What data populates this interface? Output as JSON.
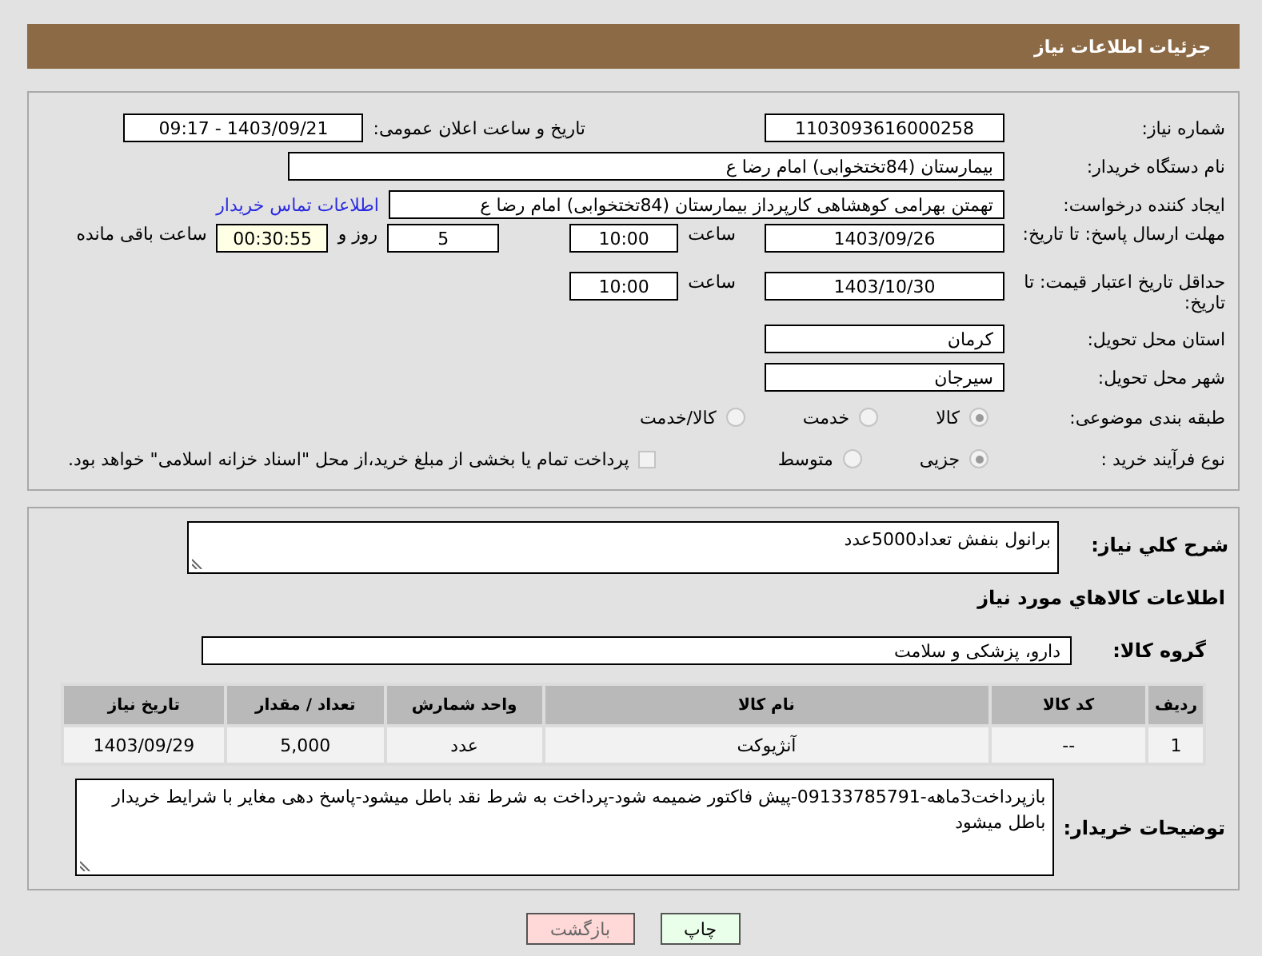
{
  "header": {
    "title": "جزئیات اطلاعات نیاز"
  },
  "need_number": {
    "label": "شماره نیاز:",
    "value": "1103093616000258"
  },
  "announce": {
    "label": "تاریخ و ساعت اعلان عمومی:",
    "value": "1403/09/21 - 09:17"
  },
  "buyer_org": {
    "label": "نام دستگاه خریدار:",
    "value": "بیمارستان (84تختخوابی) امام رضا  ع"
  },
  "creator": {
    "label": "ایجاد کننده درخواست:",
    "value": "تهمتن بهرامی کوهشاهی کارپرداز بیمارستان (84تختخوابی) امام رضا  ع",
    "link": "اطلاعات تماس خریدار"
  },
  "reply_deadline": {
    "label": "مهلت ارسال پاسخ: تا تاریخ:",
    "date": "1403/09/26",
    "time_label": "ساعت",
    "time": "10:00",
    "days": "5",
    "days_label": "روز و",
    "remaining": "00:30:55",
    "remaining_label": "ساعت باقی مانده"
  },
  "price_validity": {
    "label": "حداقل تاریخ اعتبار قیمت: تا تاریخ:",
    "date": "1403/10/30",
    "time_label": "ساعت",
    "time": "10:00"
  },
  "province": {
    "label": "استان محل تحویل:",
    "value": "کرمان"
  },
  "city": {
    "label": "شهر محل تحویل:",
    "value": "سیرجان"
  },
  "category": {
    "label": "طبقه بندی موضوعی:",
    "options": [
      {
        "label": "کالا",
        "selected": true
      },
      {
        "label": "خدمت",
        "selected": false
      },
      {
        "label": "کالا/خدمت",
        "selected": false
      }
    ]
  },
  "process": {
    "label": "نوع فرآیند خرید :",
    "options": [
      {
        "label": "جزیی",
        "selected": true
      },
      {
        "label": "متوسط",
        "selected": false
      }
    ],
    "treasury": {
      "label": "پرداخت تمام یا بخشی از مبلغ خرید،از محل \"اسناد خزانه اسلامی\" خواهد بود.",
      "checked": false
    }
  },
  "description": {
    "label": "شرح کلي نياز:",
    "value": "برانول بنفش تعداد5000عدد"
  },
  "goods_heading": "اطلاعات کالاهاي مورد نياز",
  "goods_group": {
    "label": "گروه کالا:",
    "value": "دارو، پزشکی و سلامت"
  },
  "table": {
    "columns": [
      "ردیف",
      "کد کالا",
      "نام کالا",
      "واحد شمارش",
      "تعداد / مقدار",
      "تاریخ نیاز"
    ],
    "rows": [
      [
        "1",
        "--",
        "آنژیوکت",
        "عدد",
        "5,000",
        "1403/09/29"
      ]
    ]
  },
  "buyer_notes": {
    "label": "توضیحات خریدار:",
    "value": "بازپرداخت3ماهه-09133785791-پیش فاکتور ضمیمه شود-پرداخت به شرط نقد باطل میشود-پاسخ دهی مغایر با شرایط خریدار باطل میشود"
  },
  "buttons": [
    {
      "label": "چاپ",
      "kind": "print"
    },
    {
      "label": "بازگشت",
      "kind": "back"
    }
  ]
}
